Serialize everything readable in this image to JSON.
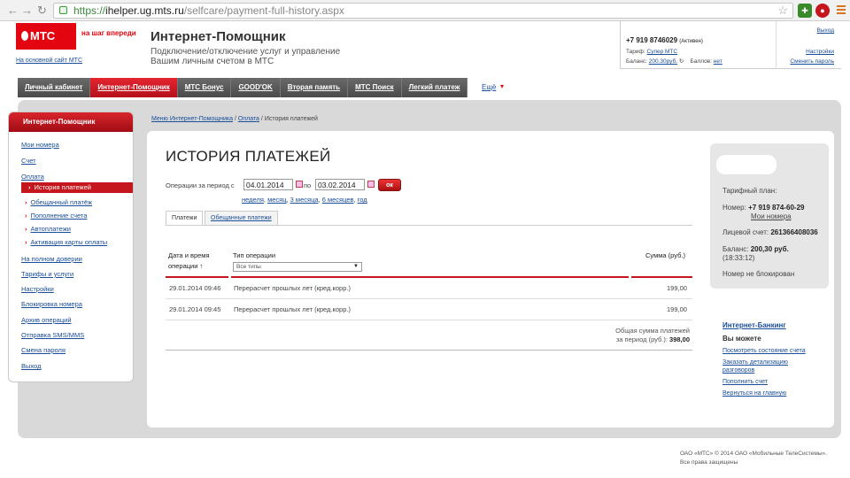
{
  "browser": {
    "url_scheme": "https://",
    "url_host": "ihelper.ug.mts.ru",
    "url_path": "/selfcare/payment-full-history.aspx"
  },
  "header": {
    "logo_text": "МТС",
    "slogan": "на шаг впереди",
    "main_site_link": "На основной сайт МТС",
    "title": "Интернет-Помощник",
    "subtitle": "Подключение/отключение услуг и управление Вашим личным счетом в МТС"
  },
  "account": {
    "phone": "+7 919 8746029",
    "status": "(Активен)",
    "tariff_label": "Тариф:",
    "tariff_value": "Супер МТС",
    "balance_label": "Баланс:",
    "balance_value": "200.30руб.",
    "points_label": "Баллов:",
    "points_value": "нет",
    "exit_link": "Выход",
    "settings_link": "Настройки",
    "change_password_link": "Сменить пароль"
  },
  "topnav": {
    "tabs": [
      "Личный кабинет",
      "Интернет-Помощник",
      "МТС Бонус",
      "GOOD'OK",
      "Вторая память",
      "МТС Поиск",
      "Легкий платеж"
    ],
    "more": "Ещё"
  },
  "sidebar": {
    "heading": "Интернет-Помощник",
    "items": [
      "Мои номера",
      "Счет",
      "Оплата",
      "История платежей",
      "Обещанный платёж",
      "Пополнение счета",
      "Автоплатежи",
      "Активация карты оплаты",
      "На полном доверии",
      "Тарифы и услуги",
      "Настройки",
      "Блокировка номера",
      "Архив операций",
      "Отправка SMS/MMS",
      "Смена пароля",
      "Выход"
    ]
  },
  "breadcrumb": {
    "items": [
      "Меню Интернет-Помощника",
      "Оплата",
      "История платежей"
    ],
    "separator": "/"
  },
  "main": {
    "title": "ИСТОРИЯ ПЛАТЕЖЕЙ",
    "period_label": "Операции за период с",
    "date_from": "04.01.2014",
    "to_label": "по",
    "date_to": "03.02.2014",
    "ok_label": "ок",
    "quick_periods": [
      "неделя",
      "месяц",
      "3 месяца",
      "6 месяцев",
      "год"
    ],
    "tabs": [
      "Платежи",
      "Обещанные платежи"
    ],
    "columns": {
      "date_line1": "Дата и время",
      "date_line2": "операции ↑",
      "type": "Тип операции",
      "amount": "Сумма (руб.)"
    },
    "type_filter": "Все типы",
    "rows": [
      {
        "date": "29.01.2014 09:46",
        "type": "Перерасчет прошлых лет (кред.корр.)",
        "amount": "199,00"
      },
      {
        "date": "29.01.2014 09:45",
        "type": "Перерасчет прошлых лет (кред.корр.)",
        "amount": "199,00"
      }
    ],
    "total_line1": "Общая сумма платежей",
    "total_line2": "за период (руб.):",
    "total_value": "398,00"
  },
  "info": {
    "tariff_plan_label": "Тарифный план:",
    "number_label": "Номер:",
    "number_value": "+7 919 874-60-29",
    "my_numbers_link": "Мои номера",
    "account_label": "Лицевой счет:",
    "account_value": "261366408036",
    "balance_label": "Баланс:",
    "balance_value": "200,30 руб.",
    "balance_time": "(18:33:12)",
    "status": "Номер не блокирован"
  },
  "internet_banking": {
    "title": "Интернет-Банкинг",
    "subtitle": "Вы можете",
    "links": [
      "Посмотреть состояние счета",
      "Заказать детализацию",
      "разговоров",
      "Пополнить счет",
      "Вернуться на главную"
    ]
  },
  "footer": {
    "line1": "ОАО «МТС» © 2014 ОАО «Мобильные ТелеСистемы».",
    "line2": "Все права защищены"
  }
}
